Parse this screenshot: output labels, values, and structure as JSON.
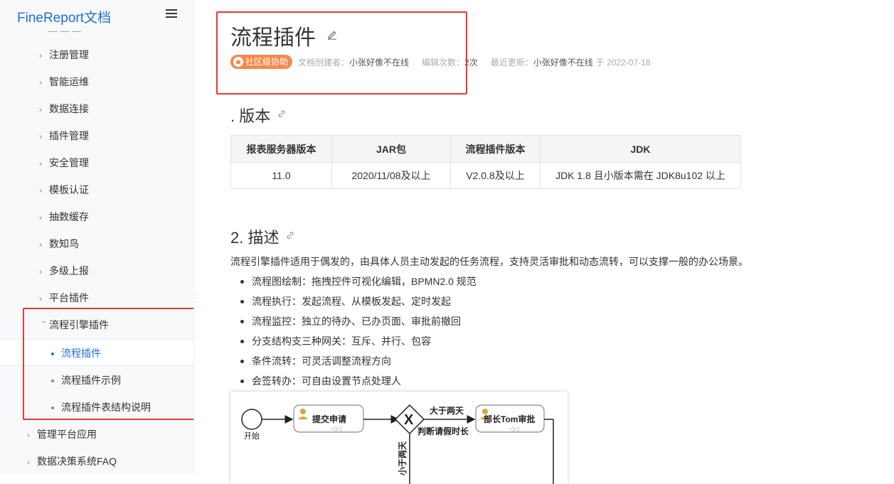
{
  "sidebar": {
    "brand": "FineReport文档",
    "menu_icon": "hamburger-icon",
    "items": [
      {
        "label": "注册管理"
      },
      {
        "label": "智能运维"
      },
      {
        "label": "数据连接"
      },
      {
        "label": "插件管理"
      },
      {
        "label": "安全管理"
      },
      {
        "label": "模板认证"
      },
      {
        "label": "抽数缓存"
      },
      {
        "label": "数知鸟"
      },
      {
        "label": "多级上报"
      },
      {
        "label": "平台插件"
      }
    ],
    "expanded_item": {
      "label": "流程引擎插件",
      "children": [
        {
          "label": "流程插件",
          "active": true
        },
        {
          "label": "流程插件示例"
        },
        {
          "label": "流程插件表结构说明"
        }
      ]
    },
    "top_items": [
      {
        "label": "管理平台应用"
      },
      {
        "label": "数据决策系统FAQ"
      }
    ]
  },
  "page": {
    "title": "流程插件",
    "badge": "社区级协助",
    "creator_label": "文档创建者：",
    "creator": "小张好像不在线",
    "edits_label": "编辑次数：",
    "edits": "2次",
    "updated_label": "最近更新：",
    "updated_by": "小张好像不在线",
    "updated_on": "于 2022-07-18"
  },
  "section1": {
    "title": ". 版本",
    "headers": [
      "报表服务器版本",
      "JAR包",
      "流程插件版本",
      "JDK"
    ],
    "row": [
      "11.0",
      "2020/11/08及以上",
      "V2.0.8及以上",
      "JDK 1.8 且小版本需在 JDK8u102 以上"
    ]
  },
  "section2": {
    "title": "2. 描述",
    "intro": "流程引擎插件适用于偶发的，由具体人员主动发起的任务流程，支持灵活审批和动态流转，可以支撑一般的办公场景。",
    "features": [
      "流程图绘制：拖拽控件可视化编辑，BPMN2.0 规范",
      "流程执行：发起流程、从模板发起、定时发起",
      "流程监控：独立的待办、已办页面、审批前撤回",
      "分支结构支三种网关：互斥、并行、包容",
      "条件流转：可灵活调整流程方向",
      "会签转办：可自由设置节点处理人"
    ]
  },
  "diagram": {
    "start": "开始",
    "task1": "提交申请",
    "gateway": "判断请假时长",
    "cond_gt": "大于两天",
    "cond_lt": "小于两天",
    "task2": "部长Tom审批"
  },
  "colors": {
    "brand": "#1f6fd1",
    "badge": "#f6894a",
    "highlight_box": "#e53935"
  }
}
